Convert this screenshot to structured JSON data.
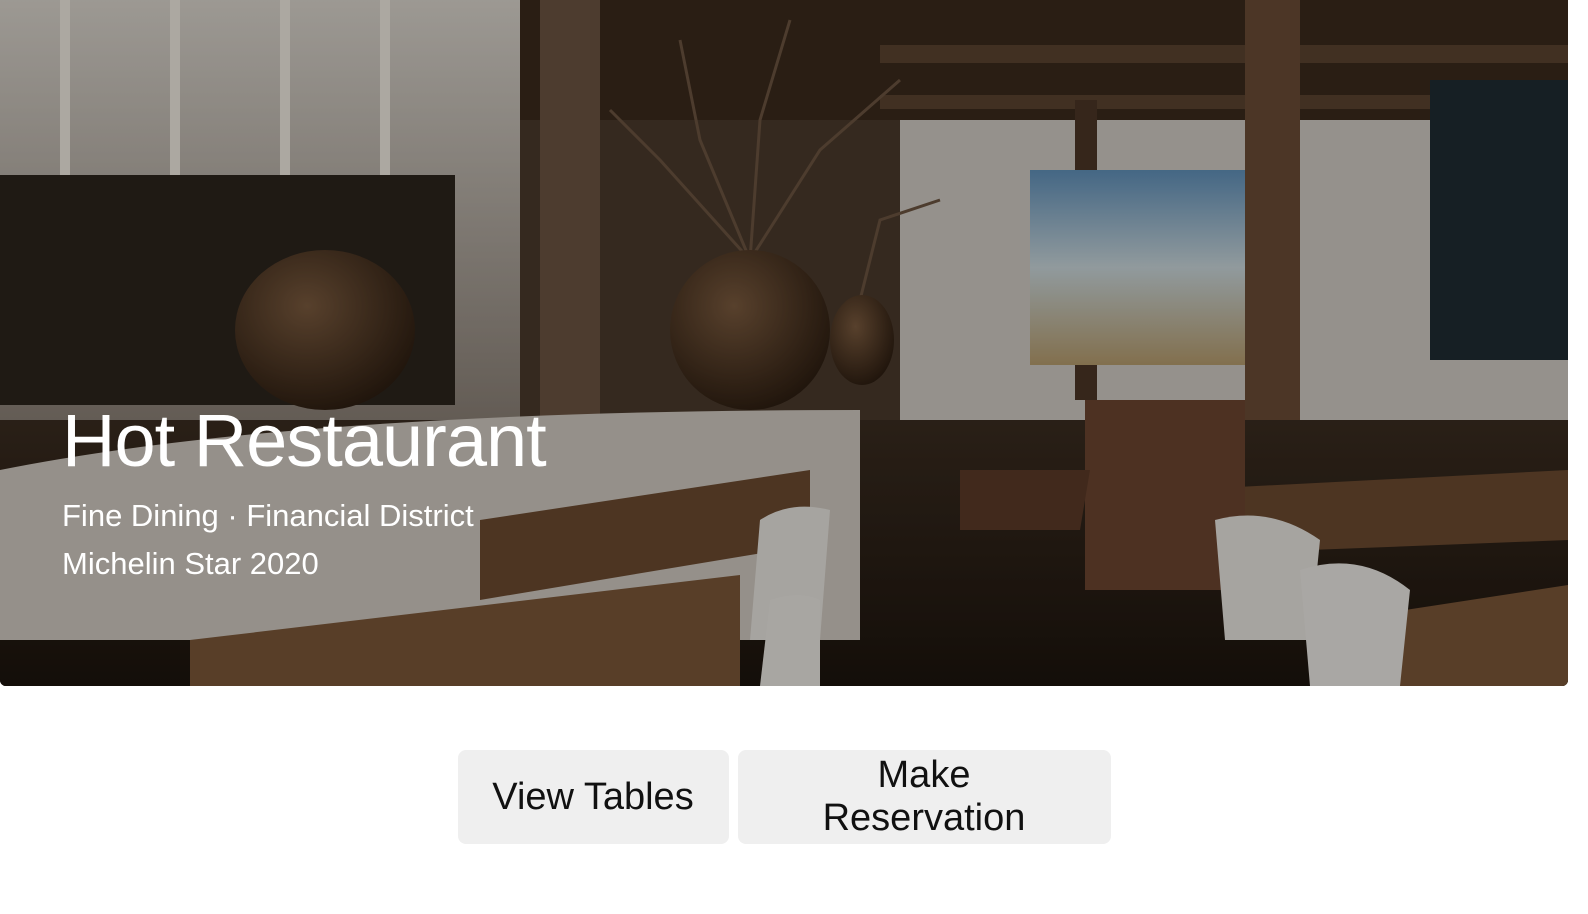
{
  "hero": {
    "title": "Hot Restaurant",
    "subtitle": "Fine Dining · Financial District",
    "award": "Michelin Star 2020",
    "image": "restaurant-interior-photo"
  },
  "actions": {
    "view_tables_label": "View Tables",
    "make_reservation_label": "Make Reservation"
  },
  "colors": {
    "button_bg": "#efefef",
    "title_text": "#ffffff",
    "button_text": "#111111"
  }
}
